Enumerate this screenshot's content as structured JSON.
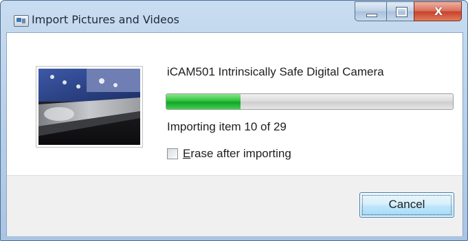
{
  "window": {
    "title": "Import Pictures and Videos",
    "app_icon": "camera-import-icon",
    "caption_buttons": {
      "minimize_icon": "minimize-icon",
      "maximize_icon": "maximize-icon",
      "close_glyph": "X"
    }
  },
  "import": {
    "device_name": "iCAM501 Intrinsically Safe Digital Camera",
    "progress_fraction": 0.26,
    "status": "Importing item 10 of 29",
    "erase_checkbox": {
      "label_mnemonic": "E",
      "label_rest": "rase after importing",
      "checked": false
    },
    "thumbnail": "camera-preview-image"
  },
  "buttons": {
    "cancel": "Cancel"
  },
  "colors": {
    "progress_green": "#10a52a",
    "title_bar": "#b5cde8",
    "close_red": "#c7412c"
  }
}
